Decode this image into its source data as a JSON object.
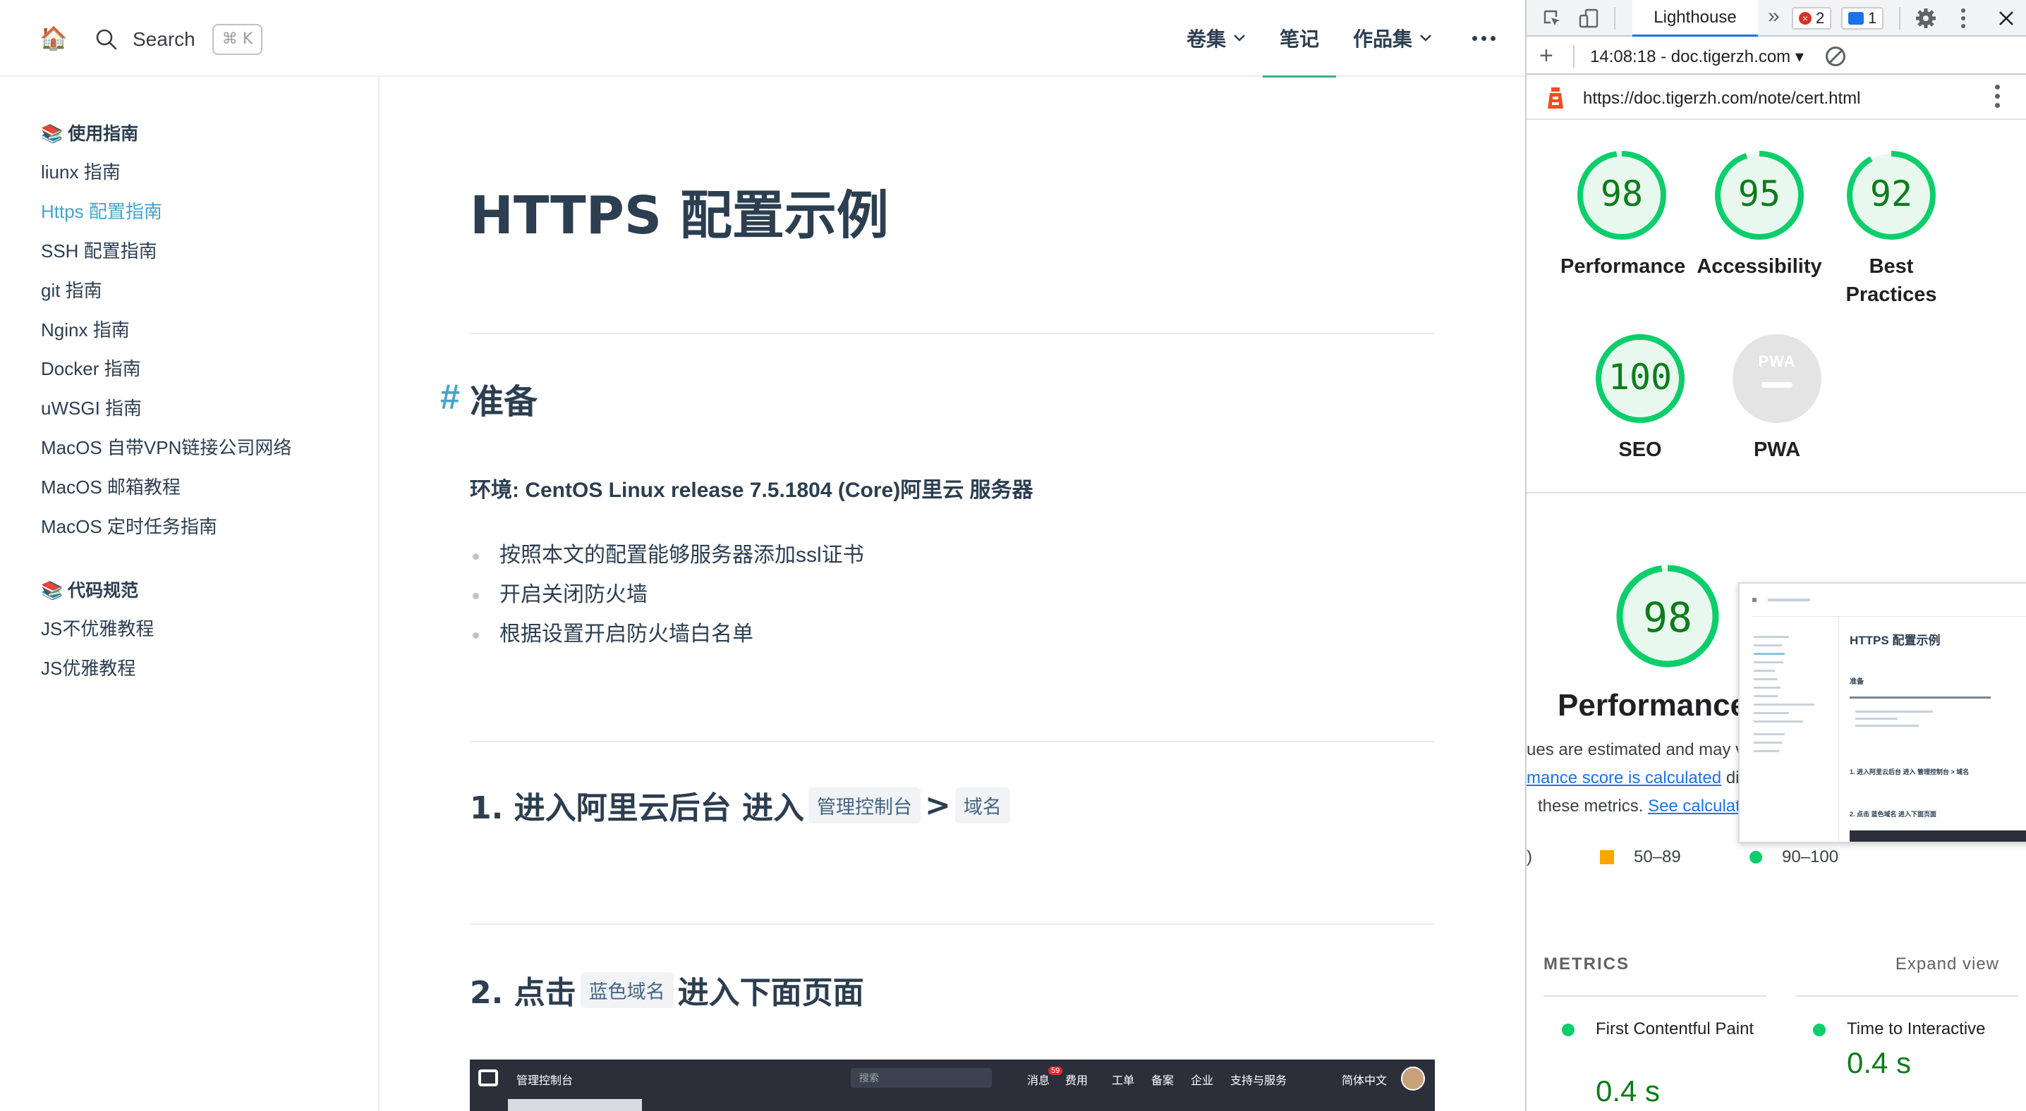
{
  "site": {
    "home_icon": "🏠",
    "search_label": "Search",
    "search_shortcut": "⌘ K",
    "nav": [
      {
        "label": "卷集",
        "dropdown": true
      },
      {
        "label": "笔记",
        "active": true
      },
      {
        "label": "作品集",
        "dropdown": true
      }
    ]
  },
  "sidebar": {
    "groups": [
      {
        "title": "📚 使用指南",
        "items": [
          "liunx 指南",
          "Https 配置指南",
          "SSH 配置指南",
          "git 指南",
          "Nginx 指南",
          "Docker 指南",
          "uWSGI 指南",
          "MacOS 自带VPN链接公司网络",
          "MacOS 邮箱教程",
          "MacOS 定时任务指南"
        ]
      },
      {
        "title": "📚 代码规范",
        "items": [
          "JS不优雅教程",
          "JS优雅教程"
        ]
      }
    ],
    "active_item": "Https 配置指南"
  },
  "article": {
    "title": "HTTPS 配置示例",
    "hash": "#",
    "section1": "准备",
    "env": "环境: CentOS Linux release 7.5.1804 (Core)阿里云 服务器",
    "bullets": [
      "按照本文的配置能够服务器添加ssl证书",
      "开启关闭防火墙",
      "根据设置开启防火墙白名单"
    ],
    "section2_prefix": "1. 进入阿里云后台 进入",
    "section2_code1": "管理控制台",
    "section2_gt": ">",
    "section2_code2": "域名",
    "section3_prefix": "2. 点击",
    "section3_code": "蓝色域名",
    "section3_suffix": "进入下面页面",
    "aliyun": {
      "console": "管理控制台",
      "search": "搜索",
      "nav": [
        "消息",
        "费用",
        "工单",
        "备案",
        "企业",
        "支持与服务"
      ],
      "badge": "59",
      "lang": "简体中文"
    }
  },
  "devtools": {
    "tab": "Lighthouse",
    "errors": "2",
    "messages": "1",
    "report": "14:08:18 - doc.tigerzh.com",
    "url": "https://doc.tigerzh.com/note/cert.html",
    "scores": [
      {
        "label": "Performance",
        "value": "98"
      },
      {
        "label": "Accessibility",
        "value": "95"
      },
      {
        "label": "Best Practices",
        "value": "92"
      },
      {
        "label": "SEO",
        "value": "100"
      },
      {
        "label": "PWA",
        "value": ""
      }
    ],
    "pwa_text": "PWA",
    "perf_score": "98",
    "perf_title": "Performance",
    "perf_desc1": "ues are estimated and may va",
    "perf_desc2a": "mance score is calculated",
    "perf_desc2b": "di",
    "perf_desc3a": "these metrics.",
    "perf_desc3b": "See calculato",
    "legend_orange": "50–89",
    "legend_green": "90–100",
    "legend_red_tail": ")",
    "thumb": {
      "title": "HTTPS 配置示例",
      "h": "准备",
      "s1": "1. 进入阿里云后台 进入 管理控制台 > 域名",
      "s2": "2. 点击 蓝色域名 进入下面页面"
    },
    "metrics_head": "METRICS",
    "expand": "Expand view",
    "metrics": [
      {
        "name": "First Contentful Paint",
        "value": "0.4 s"
      },
      {
        "name": "Time to Interactive",
        "value": "0.4 s"
      }
    ],
    "colors": {
      "pass": "#0cce6b",
      "pass_text": "#0c7c1a",
      "average": "#ffa400"
    }
  }
}
